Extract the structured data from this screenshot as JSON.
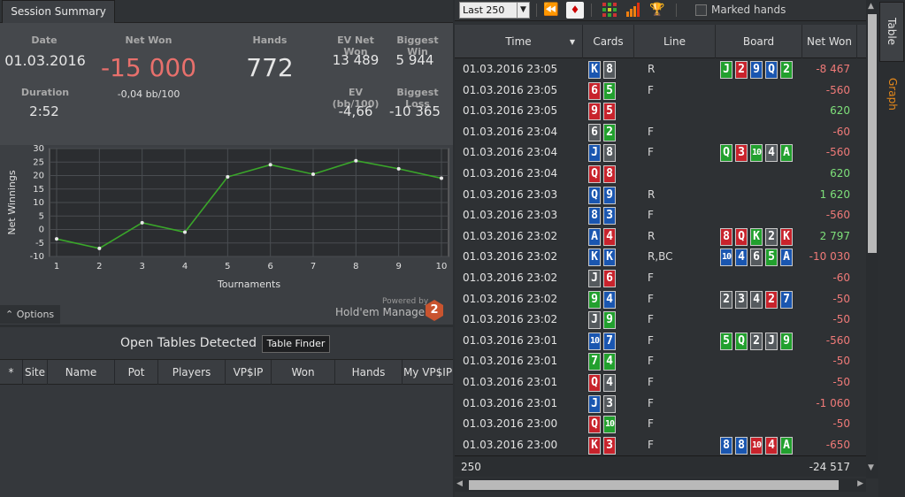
{
  "tabs": {
    "session_summary": "Session Summary",
    "table": "Table",
    "graph": "Graph"
  },
  "summary": {
    "date_label": "Date",
    "date": "01.03.2016",
    "netwon_label": "Net Won",
    "netwon": "-15 000",
    "netwon_bb": "-0,04 bb/100",
    "hands_label": "Hands",
    "hands": "772",
    "evnet_label": "EV Net Won",
    "evnet": "13 489",
    "bigwin_label": "Biggest Win",
    "bigwin": "5 944",
    "duration_label": "Duration",
    "duration": "2:52",
    "evbb_label": "EV (bb/100)",
    "evbb": "-4,66",
    "bigloss_label": "Biggest Loss",
    "bigloss": "-10 365"
  },
  "chart_data": {
    "type": "line",
    "x": [
      1,
      2,
      3,
      4,
      5,
      6,
      7,
      8,
      9,
      10
    ],
    "series": [
      {
        "values": [
          -3.5,
          -7,
          2.5,
          -1,
          19.5,
          24,
          20.5,
          25.5,
          22.5,
          19
        ]
      }
    ],
    "xlabel": "Tournaments",
    "ylabel": "Net Winnings",
    "ylim": [
      -10,
      30
    ],
    "yticks": [
      -10,
      -5,
      0,
      5,
      10,
      15,
      20,
      25,
      30
    ],
    "grid": true,
    "line_color": "#3aa62a"
  },
  "options_label": "Options",
  "powered_by": "Powered by",
  "brand": "Hold'em Manager",
  "brand_num": "2",
  "open_tables": {
    "title": "Open Tables Detected",
    "finder_button": "Table Finder",
    "columns": [
      "*",
      "Site",
      "Name",
      "Pot",
      "Players",
      "VP$IP",
      "Won",
      "Hands",
      "My VP$IP"
    ]
  },
  "toolbar": {
    "range": "Last 250",
    "marked_hands": "Marked hands"
  },
  "grid": {
    "columns": {
      "time": "Time",
      "cards": "Cards",
      "line": "Line",
      "board": "Board",
      "netwon": "Net Won"
    },
    "rows": [
      {
        "time": "01.03.2016 23:05",
        "cards": [
          [
            "K",
            "blue"
          ],
          [
            "8",
            "gray"
          ]
        ],
        "line": "R",
        "board": [
          [
            "J",
            "green"
          ],
          [
            "2",
            "red"
          ],
          [
            "9",
            "blue"
          ],
          [
            "Q",
            "blue"
          ],
          [
            "2",
            "green"
          ]
        ],
        "net": "-8 467",
        "pos": false
      },
      {
        "time": "01.03.2016 23:05",
        "cards": [
          [
            "6",
            "red"
          ],
          [
            "5",
            "green"
          ]
        ],
        "line": "F",
        "board": [],
        "net": "-560",
        "pos": false
      },
      {
        "time": "01.03.2016 23:05",
        "cards": [
          [
            "9",
            "red"
          ],
          [
            "5",
            "red"
          ]
        ],
        "line": "",
        "board": [],
        "net": "620",
        "pos": true
      },
      {
        "time": "01.03.2016 23:04",
        "cards": [
          [
            "6",
            "gray"
          ],
          [
            "2",
            "green"
          ]
        ],
        "line": "F",
        "board": [],
        "net": "-60",
        "pos": false
      },
      {
        "time": "01.03.2016 23:04",
        "cards": [
          [
            "J",
            "blue"
          ],
          [
            "8",
            "gray"
          ]
        ],
        "line": "F",
        "board": [
          [
            "Q",
            "green"
          ],
          [
            "3",
            "red"
          ],
          [
            "10",
            "green"
          ],
          [
            "4",
            "gray"
          ],
          [
            "A",
            "green"
          ]
        ],
        "net": "-560",
        "pos": false
      },
      {
        "time": "01.03.2016 23:04",
        "cards": [
          [
            "Q",
            "red"
          ],
          [
            "8",
            "red"
          ]
        ],
        "line": "",
        "board": [],
        "net": "620",
        "pos": true
      },
      {
        "time": "01.03.2016 23:03",
        "cards": [
          [
            "Q",
            "blue"
          ],
          [
            "9",
            "blue"
          ]
        ],
        "line": "R",
        "board": [],
        "net": "1 620",
        "pos": true
      },
      {
        "time": "01.03.2016 23:03",
        "cards": [
          [
            "8",
            "blue"
          ],
          [
            "3",
            "blue"
          ]
        ],
        "line": "F",
        "board": [],
        "net": "-560",
        "pos": false
      },
      {
        "time": "01.03.2016 23:02",
        "cards": [
          [
            "A",
            "blue"
          ],
          [
            "4",
            "red"
          ]
        ],
        "line": "R",
        "board": [
          [
            "8",
            "red"
          ],
          [
            "Q",
            "red"
          ],
          [
            "K",
            "green"
          ],
          [
            "2",
            "gray"
          ],
          [
            "K",
            "red"
          ]
        ],
        "net": "2 797",
        "pos": true
      },
      {
        "time": "01.03.2016 23:02",
        "cards": [
          [
            "K",
            "blue"
          ],
          [
            "K",
            "blue"
          ]
        ],
        "line": "R,BC",
        "board": [
          [
            "10",
            "blue"
          ],
          [
            "4",
            "blue"
          ],
          [
            "6",
            "gray"
          ],
          [
            "5",
            "green"
          ],
          [
            "A",
            "blue"
          ]
        ],
        "net": "-10 030",
        "pos": false
      },
      {
        "time": "01.03.2016 23:02",
        "cards": [
          [
            "J",
            "gray"
          ],
          [
            "6",
            "red"
          ]
        ],
        "line": "F",
        "board": [],
        "net": "-60",
        "pos": false
      },
      {
        "time": "01.03.2016 23:02",
        "cards": [
          [
            "9",
            "green"
          ],
          [
            "4",
            "blue"
          ]
        ],
        "line": "F",
        "board": [
          [
            "2",
            "gray"
          ],
          [
            "3",
            "gray"
          ],
          [
            "4",
            "gray"
          ],
          [
            "2",
            "red"
          ],
          [
            "7",
            "blue"
          ]
        ],
        "net": "-50",
        "pos": false
      },
      {
        "time": "01.03.2016 23:02",
        "cards": [
          [
            "J",
            "gray"
          ],
          [
            "9",
            "green"
          ]
        ],
        "line": "F",
        "board": [],
        "net": "-50",
        "pos": false
      },
      {
        "time": "01.03.2016 23:01",
        "cards": [
          [
            "10",
            "blue"
          ],
          [
            "7",
            "blue"
          ]
        ],
        "line": "F",
        "board": [
          [
            "5",
            "green"
          ],
          [
            "Q",
            "green"
          ],
          [
            "2",
            "gray"
          ],
          [
            "J",
            "gray"
          ],
          [
            "9",
            "green"
          ]
        ],
        "net": "-560",
        "pos": false
      },
      {
        "time": "01.03.2016 23:01",
        "cards": [
          [
            "7",
            "green"
          ],
          [
            "4",
            "green"
          ]
        ],
        "line": "F",
        "board": [],
        "net": "-50",
        "pos": false
      },
      {
        "time": "01.03.2016 23:01",
        "cards": [
          [
            "Q",
            "red"
          ],
          [
            "4",
            "gray"
          ]
        ],
        "line": "F",
        "board": [],
        "net": "-50",
        "pos": false
      },
      {
        "time": "01.03.2016 23:01",
        "cards": [
          [
            "J",
            "blue"
          ],
          [
            "3",
            "gray"
          ]
        ],
        "line": "F",
        "board": [],
        "net": "-1 060",
        "pos": false
      },
      {
        "time": "01.03.2016 23:00",
        "cards": [
          [
            "Q",
            "red"
          ],
          [
            "10",
            "green"
          ]
        ],
        "line": "F",
        "board": [],
        "net": "-50",
        "pos": false
      },
      {
        "time": "01.03.2016 23:00",
        "cards": [
          [
            "K",
            "red"
          ],
          [
            "3",
            "red"
          ]
        ],
        "line": "F",
        "board": [
          [
            "8",
            "blue"
          ],
          [
            "8",
            "blue"
          ],
          [
            "10",
            "red"
          ],
          [
            "4",
            "red"
          ],
          [
            "A",
            "green"
          ]
        ],
        "net": "-650",
        "pos": false
      }
    ],
    "footer_count": "250",
    "footer_total": "-24 517"
  },
  "colors": {
    "red": "#c8232c",
    "blue": "#1a56b0",
    "green": "#22a02e",
    "gray": "#555a5e",
    "pos": "#7ee07a",
    "neg": "#f07a78"
  }
}
